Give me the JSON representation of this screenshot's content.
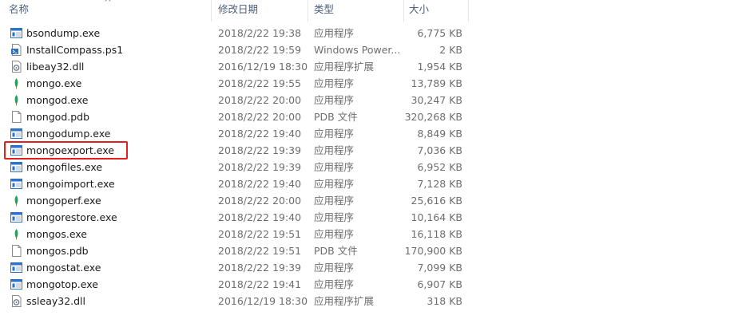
{
  "columns": {
    "name": "名称",
    "date": "修改日期",
    "type": "类型",
    "size": "大小"
  },
  "files": [
    {
      "name": "bsondump.exe",
      "date": "2018/2/22 19:38",
      "type": "应用程序",
      "size": "6,775 KB",
      "icon": "exe-window-icon"
    },
    {
      "name": "InstallCompass.ps1",
      "date": "2018/2/22 19:59",
      "type": "Windows Power...",
      "size": "2 KB",
      "icon": "powershell-script-icon"
    },
    {
      "name": "libeay32.dll",
      "date": "2016/12/19 18:30",
      "type": "应用程序扩展",
      "size": "1,954 KB",
      "icon": "dll-gear-icon"
    },
    {
      "name": "mongo.exe",
      "date": "2018/2/22 19:55",
      "type": "应用程序",
      "size": "13,789 KB",
      "icon": "mongodb-leaf-icon"
    },
    {
      "name": "mongod.exe",
      "date": "2018/2/22 20:00",
      "type": "应用程序",
      "size": "30,247 KB",
      "icon": "mongodb-leaf-icon"
    },
    {
      "name": "mongod.pdb",
      "date": "2018/2/22 20:00",
      "type": "PDB 文件",
      "size": "320,268 KB",
      "icon": "blank-file-icon"
    },
    {
      "name": "mongodump.exe",
      "date": "2018/2/22 19:40",
      "type": "应用程序",
      "size": "8,849 KB",
      "icon": "exe-window-icon"
    },
    {
      "name": "mongoexport.exe",
      "date": "2018/2/22 19:39",
      "type": "应用程序",
      "size": "7,036 KB",
      "icon": "exe-window-icon"
    },
    {
      "name": "mongofiles.exe",
      "date": "2018/2/22 19:39",
      "type": "应用程序",
      "size": "6,952 KB",
      "icon": "exe-window-icon"
    },
    {
      "name": "mongoimport.exe",
      "date": "2018/2/22 19:40",
      "type": "应用程序",
      "size": "7,128 KB",
      "icon": "exe-window-icon"
    },
    {
      "name": "mongoperf.exe",
      "date": "2018/2/22 20:00",
      "type": "应用程序",
      "size": "25,616 KB",
      "icon": "mongodb-leaf-icon"
    },
    {
      "name": "mongorestore.exe",
      "date": "2018/2/22 19:40",
      "type": "应用程序",
      "size": "10,164 KB",
      "icon": "exe-window-icon"
    },
    {
      "name": "mongos.exe",
      "date": "2018/2/22 19:51",
      "type": "应用程序",
      "size": "16,118 KB",
      "icon": "mongodb-leaf-icon"
    },
    {
      "name": "mongos.pdb",
      "date": "2018/2/22 19:51",
      "type": "PDB 文件",
      "size": "170,900 KB",
      "icon": "blank-file-icon"
    },
    {
      "name": "mongostat.exe",
      "date": "2018/2/22 19:39",
      "type": "应用程序",
      "size": "7,099 KB",
      "icon": "exe-window-icon"
    },
    {
      "name": "mongotop.exe",
      "date": "2018/2/22 19:41",
      "type": "应用程序",
      "size": "6,907 KB",
      "icon": "exe-window-icon"
    },
    {
      "name": "ssleay32.dll",
      "date": "2016/12/19 18:30",
      "type": "应用程序扩展",
      "size": "318 KB",
      "icon": "dll-gear-icon"
    }
  ],
  "highlighted_file": "mongoexport.exe",
  "colors": {
    "highlight_border": "#e2201c",
    "header_text": "#4c607a",
    "detail_text": "#6d6d6d",
    "exe_blue": "#2b72c9",
    "leaf_green": "#13aa52"
  }
}
